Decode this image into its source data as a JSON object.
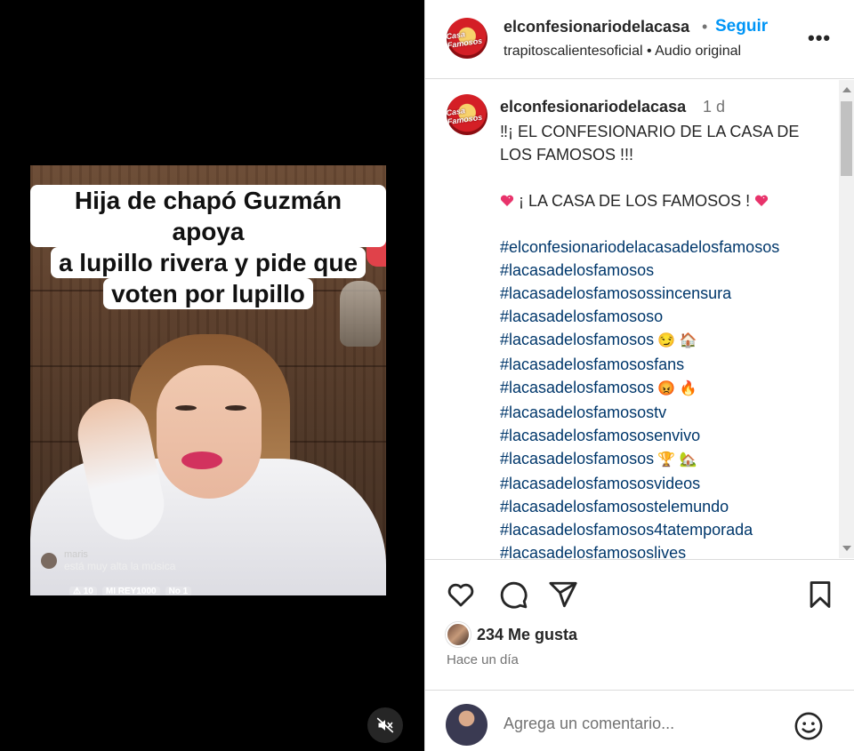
{
  "video": {
    "caption_lines": [
      "Hija de chapó Guzmán apoya",
      "a lupillo rivera y pide que",
      "voten por lupillo"
    ],
    "live_comment_user": "maris",
    "live_comment_text": "está muy alta la música",
    "live_badges": [
      "⚠ 10",
      "MI REY1000",
      "No 1"
    ]
  },
  "header": {
    "username": "elconfesionariodelacasa",
    "separator": "•",
    "follow_label": "Seguir",
    "subtitle": "trapitoscalientesoficial • Audio original",
    "more_label": "•••",
    "avatar_text": "Casa Famosos"
  },
  "caption": {
    "username": "elconfesionariodelacasa",
    "time": "1 d",
    "title": "‼¡ EL CONFESIONARIO DE LA CASA DE LOS FAMOSOS !!!",
    "subtitle_text": "¡ LA CASA DE LOS FAMOSOS !",
    "hashtags": [
      {
        "text": "#elconfesionariodelacasadelosfamosos",
        "emoji": ""
      },
      {
        "text": "#lacasadelosfamosos",
        "emoji": ""
      },
      {
        "text": "#lacasadelosfamosossincensura",
        "emoji": ""
      },
      {
        "text": "#lacasadelosfamososo",
        "emoji": ""
      },
      {
        "text": "#lacasadelosfamosos",
        "emoji": "😏 🏠"
      },
      {
        "text": "#lacasadelosfamososfans",
        "emoji": ""
      },
      {
        "text": "#lacasadelosfamosos",
        "emoji": "😡 🔥"
      },
      {
        "text": "#lacasadelosfamosostv",
        "emoji": ""
      },
      {
        "text": "#lacasadelosfamososenvivo",
        "emoji": ""
      },
      {
        "text": "#lacasadelosfamosos",
        "emoji": "🏆 🏡"
      },
      {
        "text": "#lacasadelosfamososvideos",
        "emoji": ""
      },
      {
        "text": "#lacasadelosfamosostelemundo",
        "emoji": ""
      },
      {
        "text": "#lacasadelosfamosos4tatemporada",
        "emoji": ""
      },
      {
        "text": "#lacasadelosfamososlives",
        "emoji": ""
      }
    ]
  },
  "engagement": {
    "likes": "234 Me gusta",
    "time_ago": "Hace un día"
  },
  "comment_box": {
    "placeholder": "Agrega un comentario..."
  },
  "icons": {
    "like": "heart-outline-icon",
    "comment": "speech-bubble-icon",
    "share": "paper-plane-icon",
    "save": "bookmark-icon",
    "emoji": "smiley-icon",
    "mute": "speaker-muted-icon"
  },
  "colors": {
    "accent": "#0095f6",
    "hashtag": "#00376b",
    "heart_emoji": "#e8336b",
    "text": "#262626",
    "muted": "#737373"
  }
}
